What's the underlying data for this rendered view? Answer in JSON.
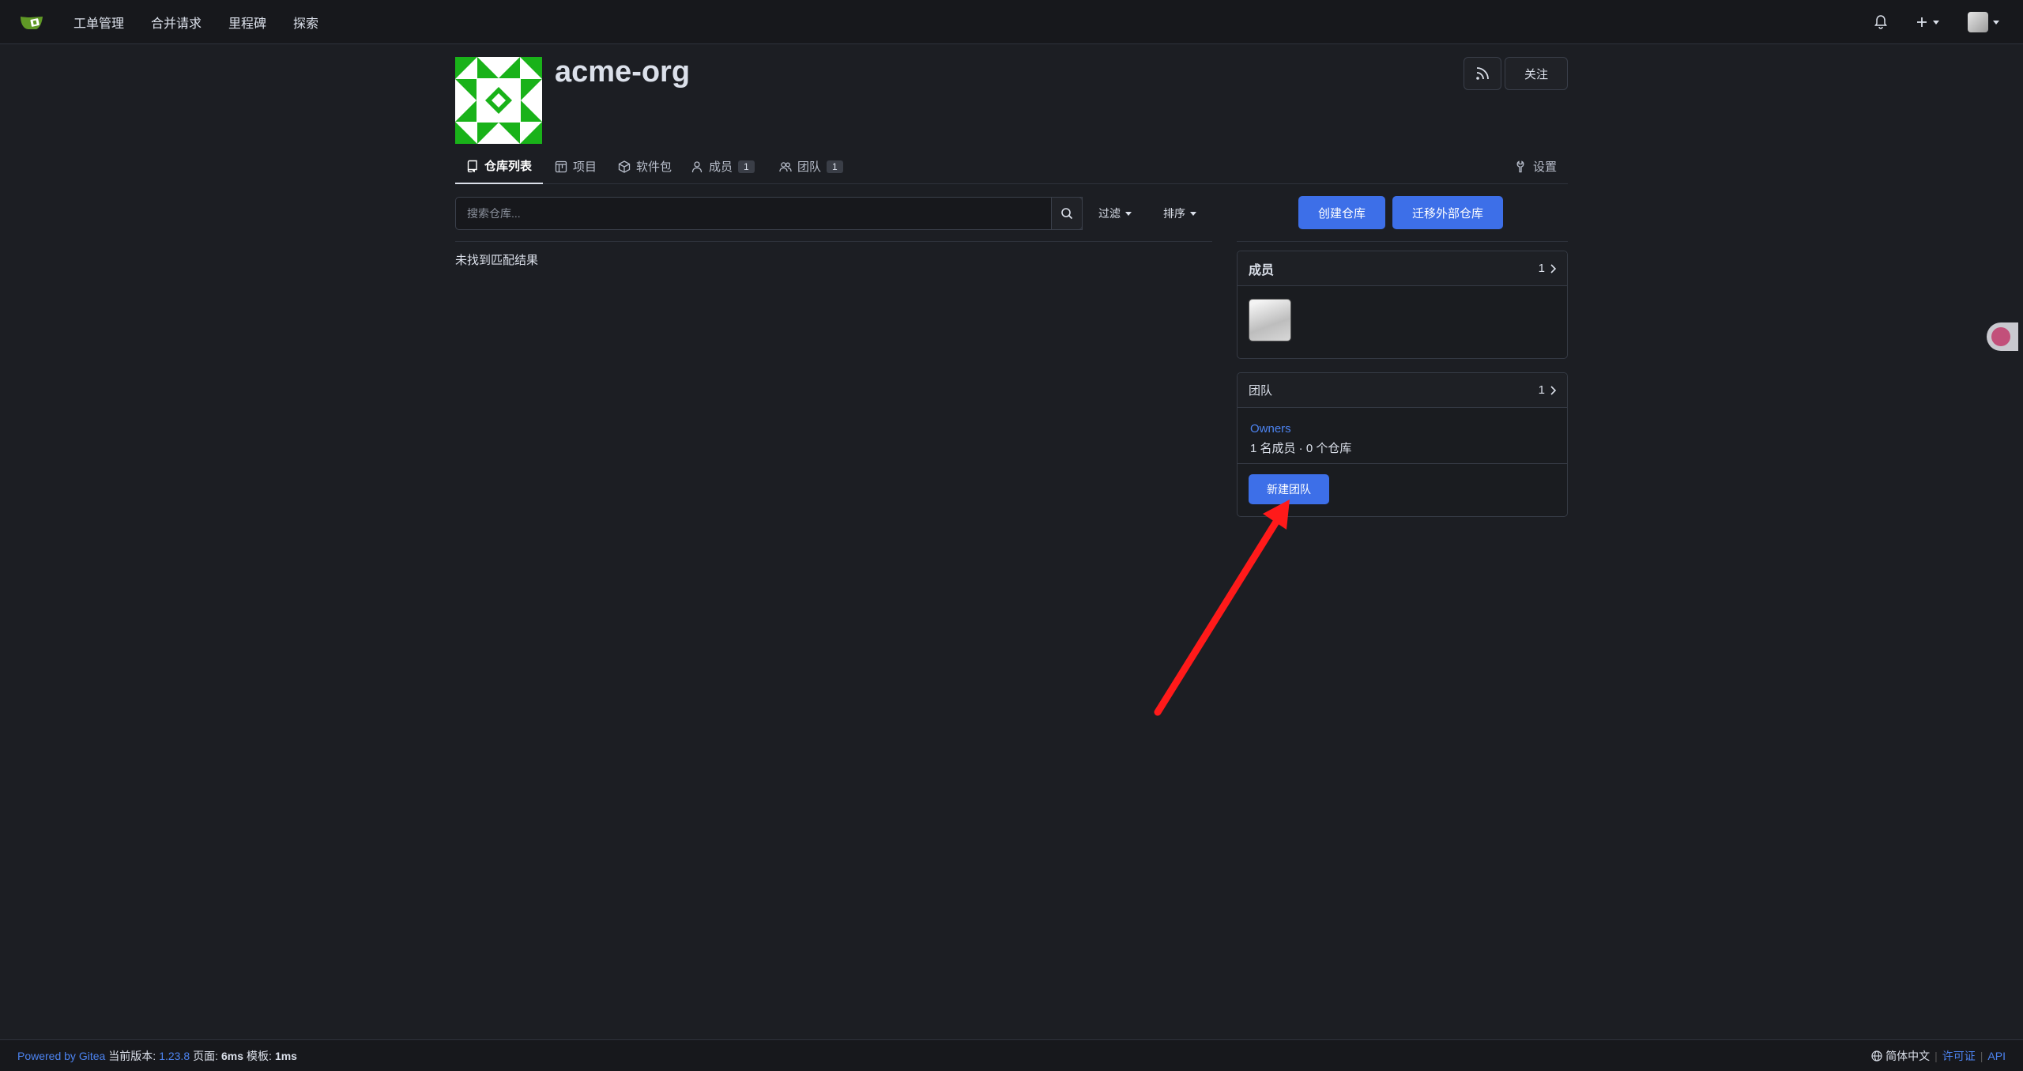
{
  "nav": {
    "items": [
      "工单管理",
      "合并请求",
      "里程碑",
      "探索"
    ]
  },
  "header": {
    "org_name": "acme-org",
    "follow_label": "关注"
  },
  "tabs": [
    {
      "label": "仓库列表",
      "icon": "repo-icon",
      "active": true
    },
    {
      "label": "项目",
      "icon": "project-icon"
    },
    {
      "label": "软件包",
      "icon": "package-icon"
    },
    {
      "label": "成员",
      "icon": "person-icon",
      "badge": "1"
    },
    {
      "label": "团队",
      "icon": "people-icon",
      "badge": "1"
    }
  ],
  "settings_label": "设置",
  "search": {
    "placeholder": "搜索仓库...",
    "filter_label": "过滤",
    "sort_label": "排序"
  },
  "empty_message": "未找到匹配结果",
  "actions": {
    "create_repo": "创建仓库",
    "migrate_repo": "迁移外部仓库"
  },
  "members_card": {
    "title": "成员",
    "count": "1"
  },
  "teams_card": {
    "title": "团队",
    "count": "1",
    "team_name": "Owners",
    "team_meta": "1 名成员 · 0 个仓库",
    "new_team_label": "新建团队"
  },
  "footer": {
    "powered_by": "Powered by Gitea",
    "version_label": "当前版本:",
    "version": "1.23.8",
    "page_label": "页面:",
    "page_time": "6ms",
    "template_label": "模板:",
    "template_time": "1ms",
    "language": "简体中文",
    "license": "许可证",
    "api": "API"
  },
  "colors": {
    "accent": "#3d6fe8",
    "link": "#4c83f0",
    "background": "#1c1e23",
    "annotation_arrow": "#ff1a1a"
  }
}
